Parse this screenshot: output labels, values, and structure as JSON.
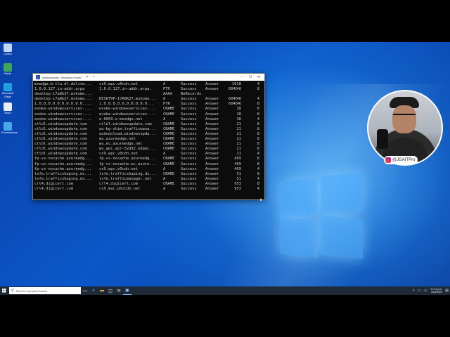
{
  "desktop": {
    "icons": [
      {
        "name": "recycle-bin-icon",
        "label": "Lixeira",
        "color": "#bfd8f5"
      },
      {
        "name": "network-icon",
        "label": "Rede",
        "color": "#3fa55a"
      },
      {
        "name": "edge-icon",
        "label": "Microsoft Edge",
        "color": "#1fa0e0"
      },
      {
        "name": "document-icon",
        "label": "Word",
        "color": "#e8eef7"
      },
      {
        "name": "tool-icon",
        "label": "Ferramentas",
        "color": "#4aa8e8"
      }
    ]
  },
  "terminal": {
    "title": "Administrador: Windows Power",
    "rows": [
      [
        "msedge.b.tlu.dl.delive...",
        "cs9.wpc.v0cdn.net",
        "A",
        "Success",
        "Answer",
        "1018",
        "4"
      ],
      [
        "1.0.0.127.in-addr.arpa",
        "1.0.0.127.in-addr.arpa.",
        "PTR",
        "Success",
        "Answer",
        "604048",
        "8"
      ],
      [
        "desktop-i7a8k27.mshome...",
        "",
        "AAAA",
        "NoRecords",
        "",
        "",
        ""
      ],
      [
        "desktop-i7a8k27.mshome...",
        "DESKTOP-I7A8K27.mshome...",
        "A",
        "Success",
        "Answer",
        "604048",
        "4"
      ],
      [
        "1.0.0.0.0.0.0.0.0.0.0....",
        "1.0.0.0.0.0.0.0.0.0.0...",
        "PTR",
        "Success",
        "Answer",
        "604048",
        "8"
      ],
      [
        "evoke-windowsservices-...",
        "evoke-windowsservices-...",
        "CNAME",
        "Success",
        "Answer",
        "38",
        "8"
      ],
      [
        "evoke-windowsservices-...",
        "evoke-windowsservices-...",
        "CNAME",
        "Success",
        "Answer",
        "38",
        "8"
      ],
      [
        "evoke-windowsservices-...",
        "e-0009.e-msedge.net",
        "A",
        "Success",
        "Answer",
        "38",
        "4"
      ],
      [
        "ctldl.windowsupdate.com",
        "ctldl.windowsupdate.com",
        "CNAME",
        "Success",
        "Answer",
        "21",
        "8"
      ],
      [
        "ctldl.windowsupdate.com",
        "au-bg-shim.trafficmana...",
        "CNAME",
        "Success",
        "Answer",
        "21",
        "8"
      ],
      [
        "ctldl.windowsupdate.com",
        "audownload.windowsupda...",
        "CNAME",
        "Success",
        "Answer",
        "21",
        "8"
      ],
      [
        "ctldl.windowsupdate.com",
        "wu.azureedge.net",
        "CNAME",
        "Success",
        "Answer",
        "21",
        "8"
      ],
      [
        "ctldl.windowsupdate.com",
        "wu.ec.azureedge.net",
        "CNAME",
        "Success",
        "Answer",
        "21",
        "8"
      ],
      [
        "ctldl.windowsupdate.com",
        "wu.wpc.apr-52dd2.edgec...",
        "CNAME",
        "Success",
        "Answer",
        "21",
        "8"
      ],
      [
        "ctldl.windowsupdate.com",
        "cs9.wpc.v0cdn.net",
        "A",
        "Success",
        "Answer",
        "21",
        "4"
      ],
      [
        "fp-vs-nocache.azureedg...",
        "fp-vs-nocache.azureedg...",
        "CNAME",
        "Success",
        "Answer",
        "469",
        "8"
      ],
      [
        "fp-vs-nocache.azureedg...",
        "fp-vs-nocache.ec.azure...",
        "CNAME",
        "Success",
        "Answer",
        "469",
        "8"
      ],
      [
        "fp-vs-nocache.azureedg...",
        "cs9.wpc.v0cdn.net",
        "A",
        "Success",
        "Answer",
        "469",
        "4"
      ],
      [
        "tsfe.trafficshaping.ds...",
        "tsfe.trafficshaping.ds...",
        "CNAME",
        "Success",
        "Answer",
        "51",
        "8"
      ],
      [
        "tsfe.trafficshaping.ds...",
        "tsfe.trafficmanager.net",
        "A",
        "Success",
        "Answer",
        "51",
        "4"
      ],
      [
        "crl4.digicert.com",
        "crl4.digicert.com",
        "CNAME",
        "Success",
        "Answer",
        "953",
        "8"
      ],
      [
        "crl4.digicert.com",
        "cs9.mac.phicdn.net",
        "A",
        "Success",
        "Answer",
        "953",
        "4"
      ]
    ]
  },
  "overlay": {
    "handle": "@JGAITPro"
  },
  "taskbar": {
    "search_placeholder": "Escribe aqui para buscar",
    "time": "17:21 p.m.",
    "date": "4/16/2020"
  }
}
